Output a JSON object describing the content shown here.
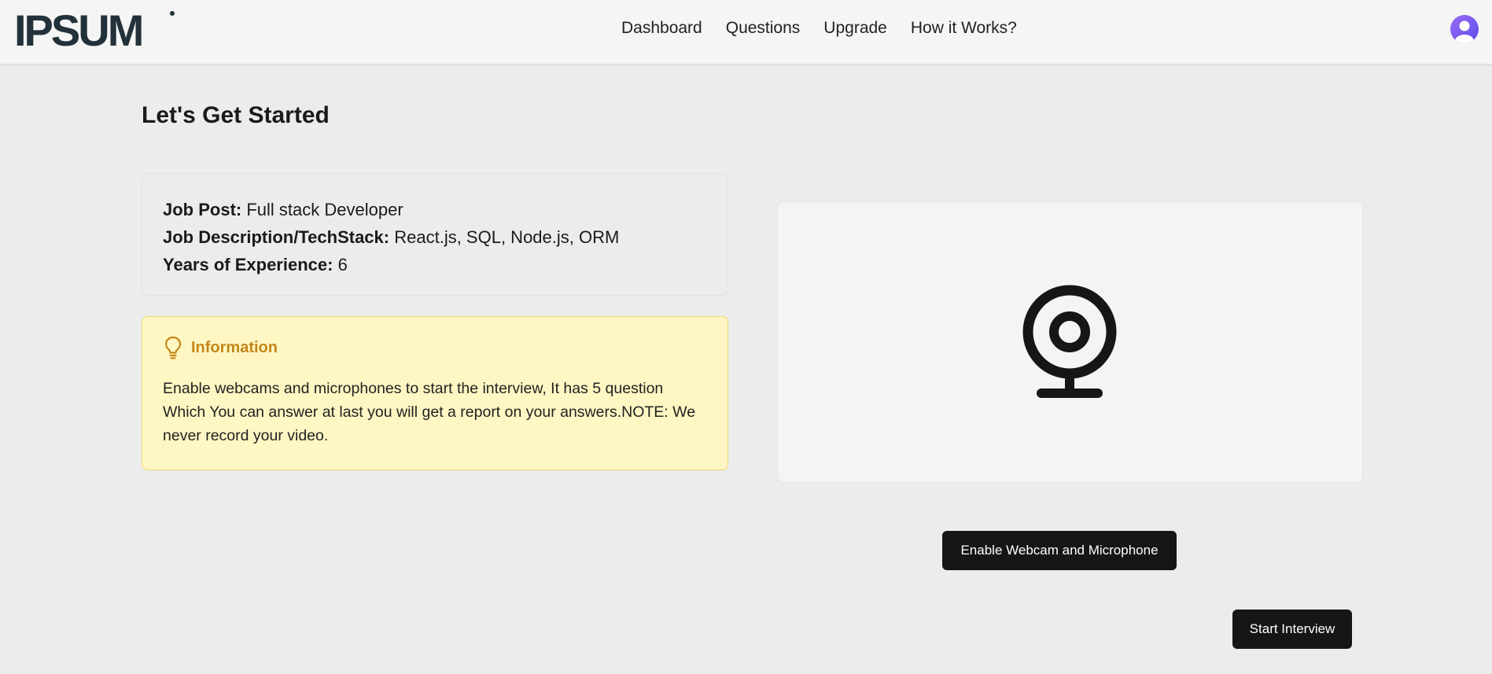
{
  "header": {
    "logo_text": "IPSUM",
    "nav": [
      "Dashboard",
      "Questions",
      "Upgrade",
      "How it Works?"
    ]
  },
  "page": {
    "title": "Let's Get Started"
  },
  "job": {
    "post_label": "Job Post:",
    "post_value": "Full stack Developer",
    "desc_label": "Job Description/TechStack:",
    "desc_value": "React.js, SQL, Node.js, ORM",
    "exp_label": "Years of Experience:",
    "exp_value": "6"
  },
  "info": {
    "title": "Information",
    "text": "Enable webcams and microphones to start the interview, It has 5 question Which You can answer at last you will get a report on your answers.NOTE: We never record your video."
  },
  "buttons": {
    "enable": "Enable Webcam and Microphone",
    "start": "Start Interview"
  },
  "colors": {
    "accent": "#161616",
    "info_bg": "#fef7c3",
    "info_title": "#c4861a",
    "avatar": "#7c5cf0"
  }
}
